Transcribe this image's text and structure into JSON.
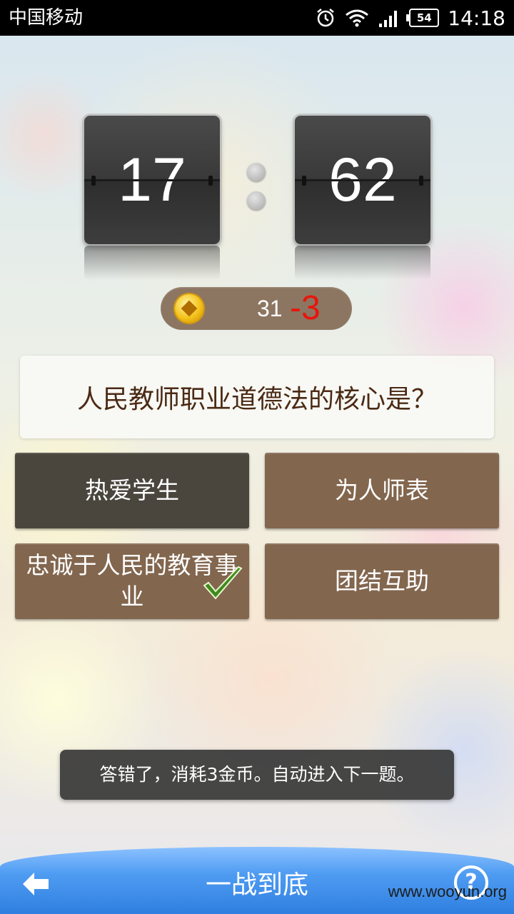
{
  "status_bar": {
    "carrier": "中国移动",
    "battery": "54",
    "time": "14:18",
    "icons": [
      "alarm-icon",
      "wifi-icon",
      "signal-icon",
      "battery-icon"
    ]
  },
  "timer": {
    "left": "17",
    "right": "62"
  },
  "score": {
    "coins": "31",
    "delta": "-3"
  },
  "question": {
    "text": "人民教师职业道德法的核心是？"
  },
  "answers": [
    {
      "label": "热爱学生",
      "state": "selected"
    },
    {
      "label": "为人师表",
      "state": "normal"
    },
    {
      "label": "忠诚于人民的教育事业",
      "state": "correct"
    },
    {
      "label": "团结互助",
      "state": "normal"
    }
  ],
  "toast": {
    "message": "答错了，消耗3金币。自动进入下一题。"
  },
  "bottom_bar": {
    "title": "一战到底",
    "help": "?"
  },
  "watermark": "www.wooyun.org",
  "colors": {
    "answer_bg": "#82664e",
    "answer_selected_bg": "#4a463e",
    "delta_red": "#e8150c",
    "bottom_bar_blue": "#4f9cf2"
  }
}
